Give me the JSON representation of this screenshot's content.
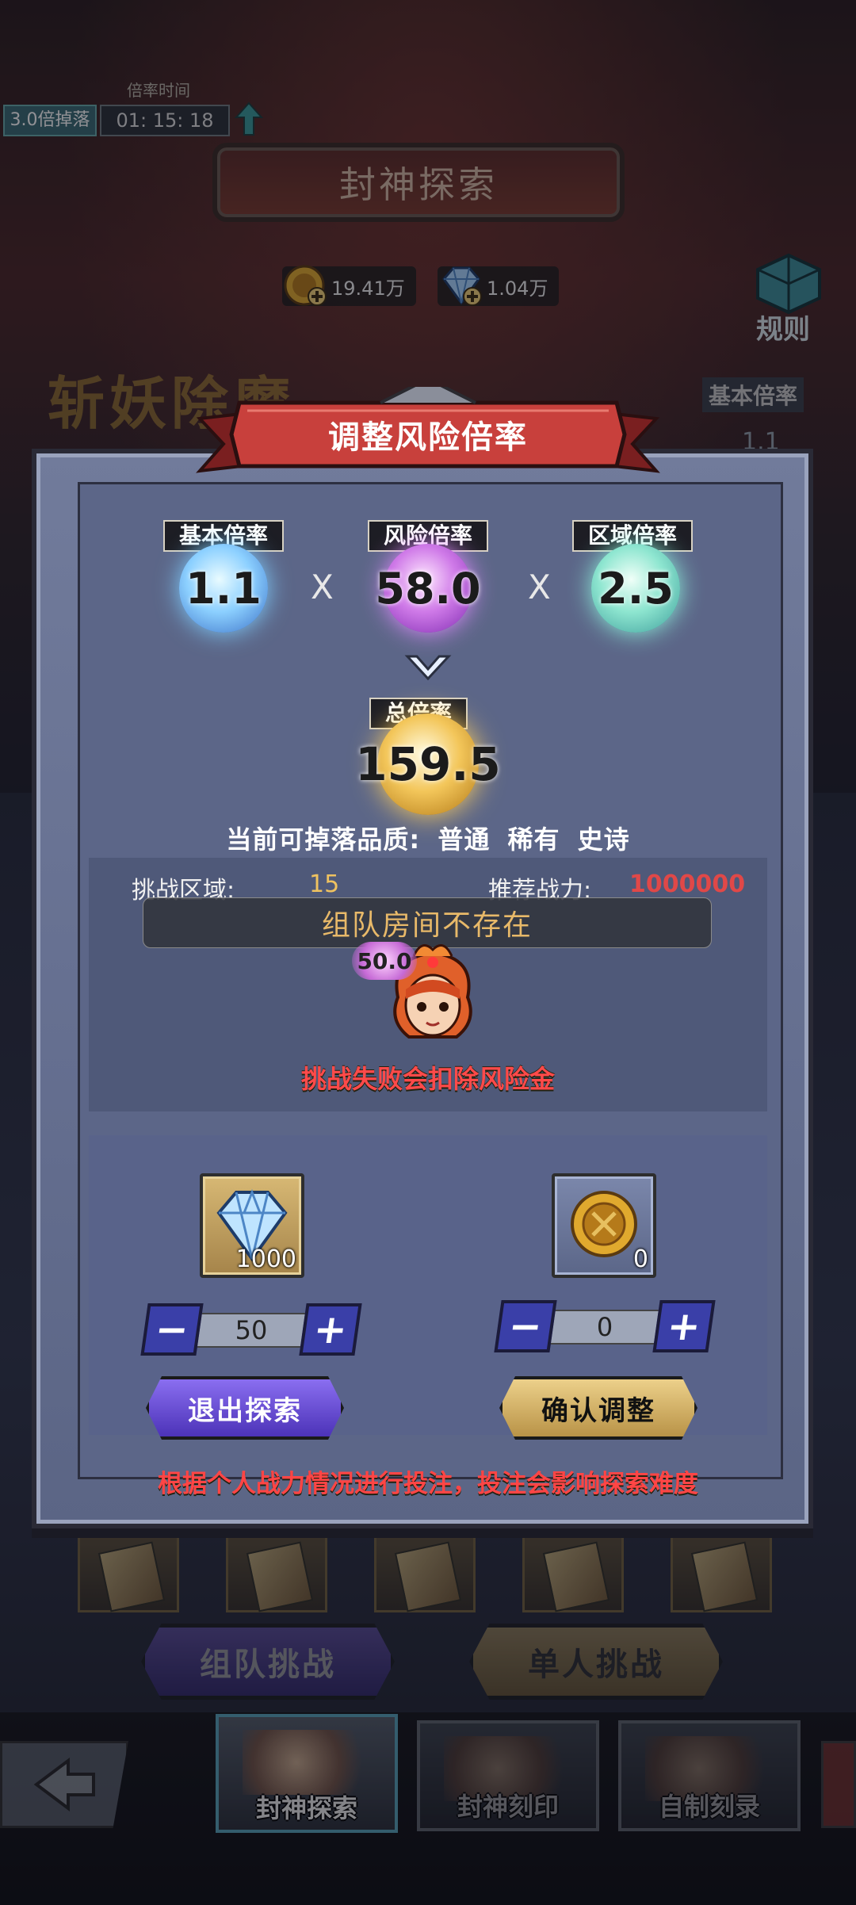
{
  "top_bar": {
    "rate_time_label": "倍率时间",
    "rate_badge": "3.0倍掉落",
    "rate_timer": "01: 15: 18"
  },
  "page_title": "封神探索",
  "currencies": {
    "gold": "19.41万",
    "diamond": "1.04万"
  },
  "rules_label": "规则",
  "background": {
    "banner_text": "斩妖除魔",
    "side_base_label": "基本倍率",
    "side_base_value": "1.1"
  },
  "dialog": {
    "title": "调整风险倍率",
    "multipliers": [
      {
        "label": "基本倍率",
        "value": "1.1"
      },
      {
        "label": "风险倍率",
        "value": "58.0"
      },
      {
        "label": "区域倍率",
        "value": "2.5"
      }
    ],
    "times_symbol": "X",
    "total_label": "总倍率",
    "total_value": "159.5",
    "quality_label": "当前可掉落品质:",
    "qualities": [
      "普通",
      "稀有",
      "史诗"
    ],
    "zone_label": "挑战区域:",
    "zone_value": "15",
    "power_label": "推荐战力:",
    "power_value": "1000000",
    "toast": "组队房间不存在",
    "avatar_bubble": "50.0",
    "fail_warning": "挑战失败会扣除风险金",
    "diamond_stake": {
      "owned": "1000",
      "amount": "50"
    },
    "gold_stake": {
      "owned": "0",
      "amount": "0"
    },
    "minus_symbol": "−",
    "plus_symbol": "+",
    "exit_label": "退出探索",
    "confirm_label": "确认调整",
    "bet_note": "根据个人战力情况进行投注，投注会影响探索难度"
  },
  "bottom_buttons": {
    "team": "组队挑战",
    "solo": "单人挑战"
  },
  "nav": {
    "tabs": [
      {
        "label": "封神探索",
        "active": true
      },
      {
        "label": "封神刻印",
        "active": false
      },
      {
        "label": "自制刻录",
        "active": false
      }
    ]
  },
  "colors": {
    "warning_red": "#ff4545",
    "power_red": "#e04848",
    "toast_gold": "#e8b969",
    "dialog_blue": "#646e8f"
  }
}
